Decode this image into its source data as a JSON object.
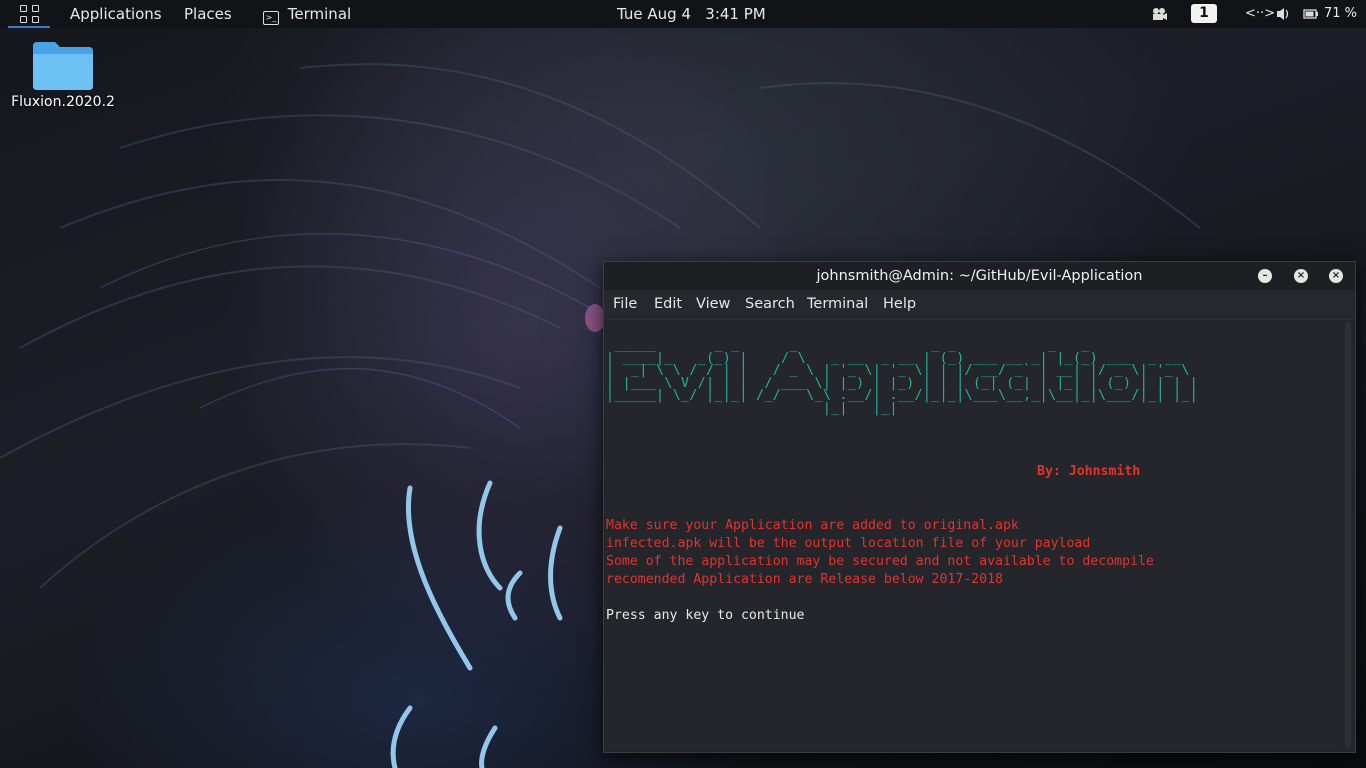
{
  "topbar": {
    "applications": "Applications",
    "places": "Places",
    "terminal": "Terminal",
    "clock": "Tue Aug 4   3:41 PM",
    "workspace": "1",
    "battery": "71 %"
  },
  "desktop": {
    "folder_label": "Fluxion.2020.2"
  },
  "terminal_window": {
    "title": "johnsmith@Admin: ~/GitHub/Evil-Application",
    "menu": [
      "File",
      "Edit",
      "View",
      "Search",
      "Terminal",
      "Help"
    ],
    "banner_art": " _____       _ _      _                _ _           _   _             \n| ____|_   _(_) |    / \\   _ __  _ __ | (_) ___ __ _| |_(_) ___  _ __  \n|  _| \\ \\ / / | |   / _ \\ | '_ \\| '_ \\| | |/ __/ _` | __| |/ _ \\| '_ \\ \n| |___ \\ V /| | |  / ___ \\| |_) | |_) | | | (_| (_| | |_| | (_) | | | |\n|_____| \\_/ |_|_| /_/   \\_\\ .__/| .__/|_|_|\\___\\__,_|\\__|_|\\___/|_| |_|\n                          |_|   |_|                                   ",
    "author": "By: Johnsmith",
    "lines": [
      "Make sure your Application are added to original.apk",
      "infected.apk will be the output location file of your payload",
      "Some of the application may be secured and not available to decompile",
      "recomended Application are Release below 2017-2018"
    ],
    "prompt": "Press any key to continue"
  },
  "colors": {
    "banner": "#1fb3a0",
    "warning": "#e0342e",
    "terminal_bg": "#24262c"
  }
}
